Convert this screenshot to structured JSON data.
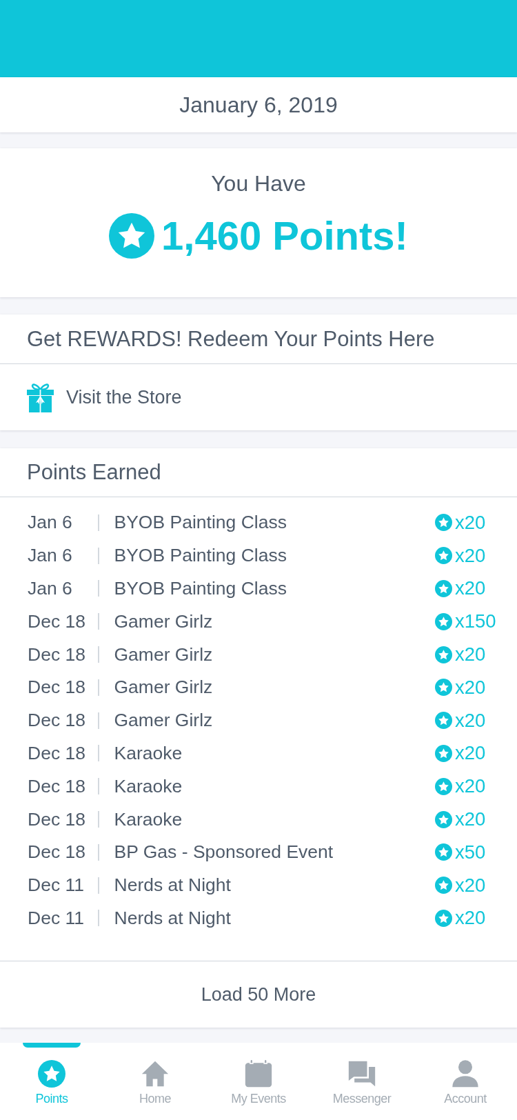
{
  "header": {
    "date": "January 6, 2019"
  },
  "balance": {
    "label": "You Have",
    "points": "1,460 Points!"
  },
  "rewards": {
    "title": "Get REWARDS! Redeem Your Points Here",
    "store_link": "Visit the Store"
  },
  "points_earned": {
    "title": "Points Earned",
    "rows": [
      {
        "date": "Jan 6",
        "event": "BYOB Painting Class",
        "points": "x20"
      },
      {
        "date": "Jan 6",
        "event": "BYOB Painting Class",
        "points": "x20"
      },
      {
        "date": "Jan 6",
        "event": "BYOB Painting Class",
        "points": "x20"
      },
      {
        "date": "Dec 18",
        "event": "Gamer Girlz",
        "points": "x150"
      },
      {
        "date": "Dec 18",
        "event": "Gamer Girlz",
        "points": "x20"
      },
      {
        "date": "Dec 18",
        "event": "Gamer Girlz",
        "points": "x20"
      },
      {
        "date": "Dec 18",
        "event": "Gamer Girlz",
        "points": "x20"
      },
      {
        "date": "Dec 18",
        "event": "Karaoke",
        "points": "x20"
      },
      {
        "date": "Dec 18",
        "event": "Karaoke",
        "points": "x20"
      },
      {
        "date": "Dec 18",
        "event": "Karaoke",
        "points": "x20"
      },
      {
        "date": "Dec 18",
        "event": "BP Gas - Sponsored Event",
        "points": "x50"
      },
      {
        "date": "Dec 11",
        "event": "Nerds at Night",
        "points": "x20"
      },
      {
        "date": "Dec 11",
        "event": "Nerds at Night",
        "points": "x20"
      }
    ],
    "load_more": "Load 50 More"
  },
  "tabs": [
    {
      "label": "Points",
      "kind": "points",
      "selected": true
    },
    {
      "label": "Home",
      "kind": "home",
      "selected": false
    },
    {
      "label": "My Events",
      "kind": "events",
      "selected": false
    },
    {
      "label": "Messenger",
      "kind": "messenger",
      "selected": false
    },
    {
      "label": "Account",
      "kind": "account",
      "selected": false
    }
  ]
}
